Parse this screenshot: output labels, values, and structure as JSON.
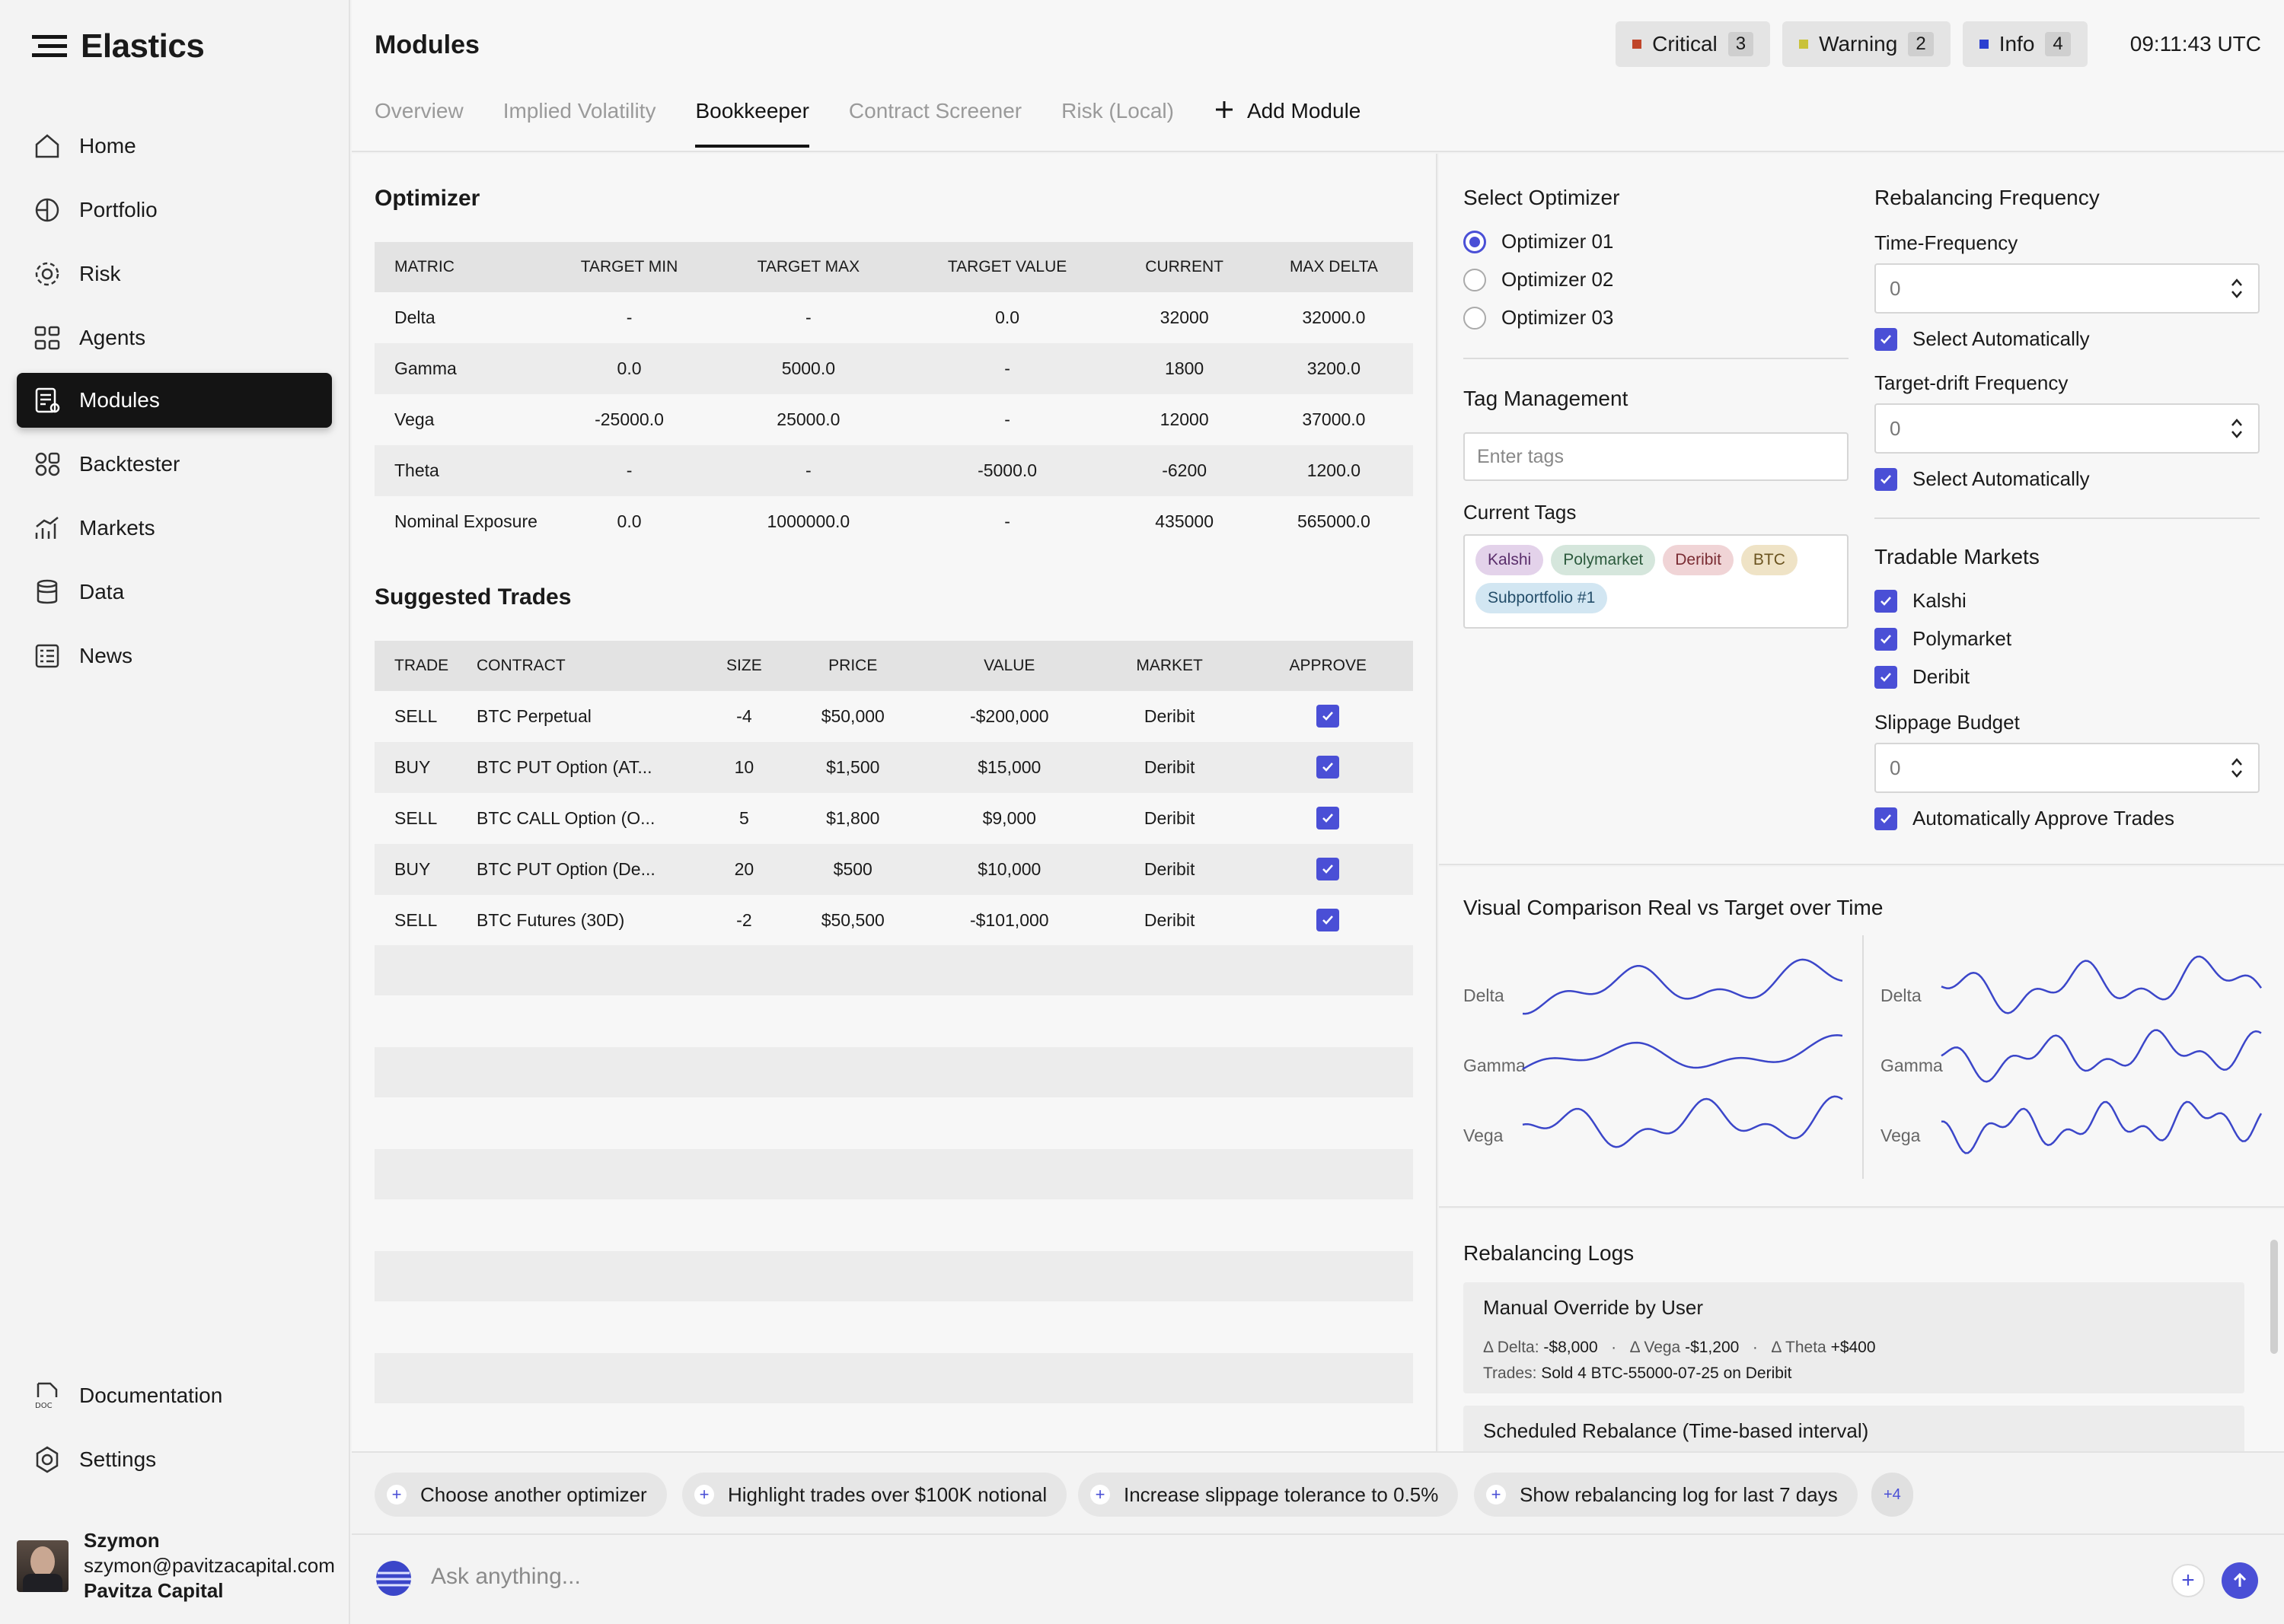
{
  "app": {
    "name": "Elastics"
  },
  "sidebar": {
    "items": [
      {
        "label": "Home",
        "icon": "home-icon"
      },
      {
        "label": "Portfolio",
        "icon": "portfolio-icon"
      },
      {
        "label": "Risk",
        "icon": "risk-icon"
      },
      {
        "label": "Agents",
        "icon": "agents-icon"
      },
      {
        "label": "Modules",
        "icon": "modules-icon",
        "active": true
      },
      {
        "label": "Backtester",
        "icon": "backtester-icon"
      },
      {
        "label": "Markets",
        "icon": "markets-icon"
      },
      {
        "label": "Data",
        "icon": "data-icon"
      },
      {
        "label": "News",
        "icon": "news-icon"
      }
    ],
    "bottom": [
      {
        "label": "Documentation",
        "icon": "doc-icon"
      },
      {
        "label": "Settings",
        "icon": "settings-icon"
      }
    ],
    "user": {
      "name": "Szymon",
      "email": "szymon@pavitzacapital.com",
      "company": "Pavitza Capital"
    }
  },
  "header": {
    "title": "Modules",
    "alerts": [
      {
        "label": "Critical",
        "count": "3",
        "color": "#c0462a"
      },
      {
        "label": "Warning",
        "count": "2",
        "color": "#c9c23a"
      },
      {
        "label": "Info",
        "count": "4",
        "color": "#2b3fd0"
      }
    ],
    "clock": "09:11:43 UTC",
    "tabs": [
      "Overview",
      "Implied Volatility",
      "Bookkeeper",
      "Contract Screener",
      "Risk (Local)"
    ],
    "active_tab": "Bookkeeper",
    "add_module": "Add Module"
  },
  "optimizer": {
    "title": "Optimizer",
    "columns": [
      "MATRIC",
      "TARGET MIN",
      "TARGET MAX",
      "TARGET VALUE",
      "CURRENT",
      "MAX DELTA"
    ],
    "rows": [
      [
        "Delta",
        "-",
        "-",
        "0.0",
        "32000",
        "32000.0"
      ],
      [
        "Gamma",
        "0.0",
        "5000.0",
        "-",
        "1800",
        "3200.0"
      ],
      [
        "Vega",
        "-25000.0",
        "25000.0",
        "-",
        "12000",
        "37000.0"
      ],
      [
        "Theta",
        "-",
        "-",
        "-5000.0",
        "-6200",
        "1200.0"
      ],
      [
        "Nominal Exposure",
        "0.0",
        "1000000.0",
        "-",
        "435000",
        "565000.0"
      ]
    ]
  },
  "trades": {
    "title": "Suggested Trades",
    "columns": [
      "TRADE",
      "CONTRACT",
      "SIZE",
      "PRICE",
      "VALUE",
      "MARKET",
      "APPROVE"
    ],
    "rows": [
      [
        "SELL",
        "BTC Perpetual",
        "-4",
        "$50,000",
        "-$200,000",
        "Deribit"
      ],
      [
        "BUY",
        "BTC PUT Option (AT...",
        "10",
        "$1,500",
        "$15,000",
        "Deribit"
      ],
      [
        "SELL",
        "BTC CALL Option (O...",
        "5",
        "$1,800",
        "$9,000",
        "Deribit"
      ],
      [
        "BUY",
        "BTC PUT Option (De...",
        "20",
        "$500",
        "$10,000",
        "Deribit"
      ],
      [
        "SELL",
        "BTC Futures (30D)",
        "-2",
        "$50,500",
        "-$101,000",
        "Deribit"
      ]
    ]
  },
  "select_optimizer": {
    "title": "Select Optimizer",
    "options": [
      "Optimizer 01",
      "Optimizer 02",
      "Optimizer 03"
    ],
    "selected": "Optimizer 01"
  },
  "tag_management": {
    "title": "Tag Management",
    "placeholder": "Enter tags",
    "current_label": "Current Tags",
    "tags": [
      {
        "label": "Kalshi",
        "bg": "#e3d2ea",
        "fg": "#5a2e6b"
      },
      {
        "label": "Polymarket",
        "bg": "#d5e6dc",
        "fg": "#2c5a3d"
      },
      {
        "label": "Deribit",
        "bg": "#f0d4d6",
        "fg": "#7a2c33"
      },
      {
        "label": "BTC",
        "bg": "#efe3c6",
        "fg": "#6b5420"
      },
      {
        "label": "Subportfolio #1",
        "bg": "#d2e6f2",
        "fg": "#244e6a"
      }
    ]
  },
  "rebalancing": {
    "title": "Rebalancing Frequency",
    "time_label": "Time-Frequency",
    "time_value": "0",
    "auto_label": "Select Automatically",
    "drift_label": "Target-drift Frequency",
    "drift_value": "0"
  },
  "markets": {
    "title": "Tradable Markets",
    "items": [
      "Kalshi",
      "Polymarket",
      "Deribit"
    ],
    "slippage_label": "Slippage Budget",
    "slippage_value": "0",
    "auto_approve": "Automatically Approve Trades"
  },
  "visual": {
    "title": "Visual Comparison Real vs Target over Time",
    "labels": [
      "Delta",
      "Gamma",
      "Vega"
    ],
    "line_color": "#3b46c9"
  },
  "logs": {
    "title": "Rebalancing Logs",
    "entries": [
      {
        "title": "Manual Override by User",
        "delta_label": "Δ Delta:",
        "delta": "-$8,000",
        "vega_label": "Δ Vega",
        "vega": "-$1,200",
        "theta_label": "Δ Theta",
        "theta": "+$400",
        "trades_label": "Trades:",
        "trades": "Sold 4 BTC-55000-07-25 on Deribit"
      },
      {
        "title": "Scheduled Rebalance (Time-based interval)"
      }
    ]
  },
  "suggestions": [
    "Choose another optimizer",
    "Highlight trades over $100K notional",
    "Increase slippage tolerance to 0.5%",
    "Show rebalancing log for last 7 days"
  ],
  "more_count": "+4",
  "ask": {
    "placeholder": "Ask anything..."
  }
}
